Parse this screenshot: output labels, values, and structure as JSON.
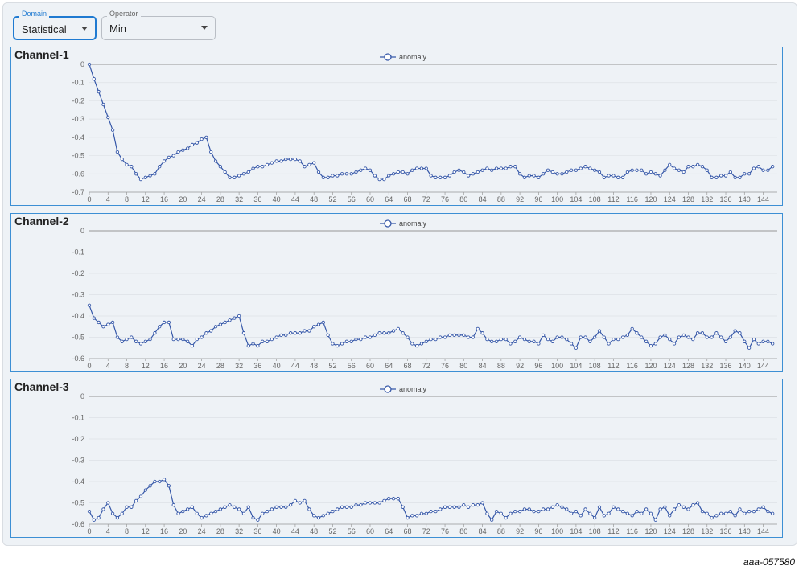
{
  "controls": {
    "domain": {
      "label": "Domain",
      "value": "Statistical"
    },
    "operator": {
      "label": "Operator",
      "value": "Min"
    }
  },
  "figure_id": "aaa-057580",
  "colors": {
    "series": "#3557a8",
    "panel_border": "#3c8fd4",
    "focus": "#1f7ad1",
    "axis": "#666666"
  },
  "chart_data": [
    {
      "type": "line",
      "title": "Channel-1",
      "legend": {
        "position": "top-center",
        "entries": [
          "anomaly"
        ]
      },
      "grid": true,
      "xlim": [
        0,
        147
      ],
      "ylim": [
        -0.7,
        0
      ],
      "x_ticks": [
        0,
        4,
        8,
        12,
        16,
        20,
        24,
        28,
        32,
        36,
        40,
        44,
        48,
        52,
        56,
        60,
        64,
        68,
        72,
        76,
        80,
        84,
        88,
        92,
        96,
        100,
        104,
        108,
        112,
        116,
        120,
        124,
        128,
        132,
        136,
        140,
        144
      ],
      "y_ticks": [
        "0",
        "-0.1",
        "-0.2",
        "-0.3",
        "-0.4",
        "-0.5",
        "-0.6",
        "-0.7"
      ],
      "series": [
        {
          "name": "anomaly",
          "values": [
            0,
            -0.08,
            -0.15,
            -0.22,
            -0.29,
            -0.36,
            -0.48,
            -0.52,
            -0.55,
            -0.56,
            -0.6,
            -0.63,
            -0.62,
            -0.61,
            -0.6,
            -0.56,
            -0.53,
            -0.51,
            -0.5,
            -0.48,
            -0.47,
            -0.46,
            -0.44,
            -0.43,
            -0.41,
            -0.4,
            -0.48,
            -0.53,
            -0.56,
            -0.59,
            -0.62,
            -0.62,
            -0.61,
            -0.6,
            -0.59,
            -0.57,
            -0.56,
            -0.56,
            -0.55,
            -0.54,
            -0.53,
            -0.53,
            -0.52,
            -0.52,
            -0.52,
            -0.53,
            -0.56,
            -0.55,
            -0.54,
            -0.59,
            -0.62,
            -0.62,
            -0.61,
            -0.61,
            -0.6,
            -0.6,
            -0.6,
            -0.59,
            -0.58,
            -0.57,
            -0.58,
            -0.61,
            -0.63,
            -0.63,
            -0.61,
            -0.6,
            -0.59,
            -0.59,
            -0.6,
            -0.58,
            -0.57,
            -0.57,
            -0.57,
            -0.61,
            -0.62,
            -0.62,
            -0.62,
            -0.61,
            -0.59,
            -0.58,
            -0.59,
            -0.61,
            -0.6,
            -0.59,
            -0.58,
            -0.57,
            -0.58,
            -0.57,
            -0.57,
            -0.57,
            -0.56,
            -0.56,
            -0.6,
            -0.62,
            -0.61,
            -0.61,
            -0.62,
            -0.6,
            -0.58,
            -0.59,
            -0.6,
            -0.6,
            -0.59,
            -0.58,
            -0.58,
            -0.57,
            -0.56,
            -0.57,
            -0.58,
            -0.59,
            -0.62,
            -0.61,
            -0.61,
            -0.62,
            -0.62,
            -0.59,
            -0.58,
            -0.58,
            -0.58,
            -0.6,
            -0.59,
            -0.6,
            -0.61,
            -0.58,
            -0.55,
            -0.57,
            -0.58,
            -0.59,
            -0.56,
            -0.56,
            -0.55,
            -0.56,
            -0.58,
            -0.62,
            -0.62,
            -0.61,
            -0.61,
            -0.59,
            -0.62,
            -0.62,
            -0.6,
            -0.6,
            -0.57,
            -0.56,
            -0.58,
            -0.58,
            -0.56
          ]
        }
      ]
    },
    {
      "type": "line",
      "title": "Channel-2",
      "legend": {
        "position": "top-center",
        "entries": [
          "anomaly"
        ]
      },
      "grid": true,
      "xlim": [
        0,
        147
      ],
      "ylim": [
        -0.6,
        0
      ],
      "x_ticks": [
        0,
        4,
        8,
        12,
        16,
        20,
        24,
        28,
        32,
        36,
        40,
        44,
        48,
        52,
        56,
        60,
        64,
        68,
        72,
        76,
        80,
        84,
        88,
        92,
        96,
        100,
        104,
        108,
        112,
        116,
        120,
        124,
        128,
        132,
        136,
        140,
        144
      ],
      "y_ticks": [
        "0",
        "-0.1",
        "-0.2",
        "-0.3",
        "-0.4",
        "-0.5",
        "-0.6"
      ],
      "series": [
        {
          "name": "anomaly",
          "values": [
            -0.35,
            -0.41,
            -0.43,
            -0.45,
            -0.44,
            -0.43,
            -0.5,
            -0.52,
            -0.51,
            -0.5,
            -0.52,
            -0.53,
            -0.52,
            -0.51,
            -0.48,
            -0.45,
            -0.43,
            -0.43,
            -0.51,
            -0.51,
            -0.51,
            -0.52,
            -0.54,
            -0.51,
            -0.5,
            -0.48,
            -0.47,
            -0.45,
            -0.44,
            -0.43,
            -0.42,
            -0.41,
            -0.4,
            -0.48,
            -0.54,
            -0.53,
            -0.54,
            -0.52,
            -0.52,
            -0.51,
            -0.5,
            -0.49,
            -0.49,
            -0.48,
            -0.48,
            -0.48,
            -0.47,
            -0.47,
            -0.45,
            -0.44,
            -0.43,
            -0.49,
            -0.53,
            -0.54,
            -0.53,
            -0.52,
            -0.52,
            -0.51,
            -0.51,
            -0.5,
            -0.5,
            -0.49,
            -0.48,
            -0.48,
            -0.48,
            -0.47,
            -0.46,
            -0.48,
            -0.5,
            -0.53,
            -0.54,
            -0.53,
            -0.52,
            -0.51,
            -0.51,
            -0.5,
            -0.5,
            -0.49,
            -0.49,
            -0.49,
            -0.49,
            -0.5,
            -0.5,
            -0.46,
            -0.48,
            -0.51,
            -0.52,
            -0.52,
            -0.51,
            -0.51,
            -0.53,
            -0.52,
            -0.5,
            -0.51,
            -0.52,
            -0.52,
            -0.53,
            -0.49,
            -0.51,
            -0.52,
            -0.5,
            -0.5,
            -0.51,
            -0.53,
            -0.55,
            -0.5,
            -0.5,
            -0.52,
            -0.5,
            -0.47,
            -0.5,
            -0.53,
            -0.51,
            -0.51,
            -0.5,
            -0.49,
            -0.46,
            -0.48,
            -0.5,
            -0.52,
            -0.54,
            -0.53,
            -0.5,
            -0.49,
            -0.51,
            -0.53,
            -0.5,
            -0.49,
            -0.5,
            -0.51,
            -0.48,
            -0.48,
            -0.5,
            -0.5,
            -0.48,
            -0.5,
            -0.52,
            -0.5,
            -0.47,
            -0.48,
            -0.52,
            -0.55,
            -0.51,
            -0.53,
            -0.52,
            -0.52,
            -0.53
          ]
        }
      ]
    },
    {
      "type": "line",
      "title": "Channel-3",
      "legend": {
        "position": "top-center",
        "entries": [
          "anomaly"
        ]
      },
      "grid": true,
      "xlim": [
        0,
        147
      ],
      "ylim": [
        -0.6,
        0
      ],
      "x_ticks": [
        0,
        4,
        8,
        12,
        16,
        20,
        24,
        28,
        32,
        36,
        40,
        44,
        48,
        52,
        56,
        60,
        64,
        68,
        72,
        76,
        80,
        84,
        88,
        92,
        96,
        100,
        104,
        108,
        112,
        116,
        120,
        124,
        128,
        132,
        136,
        140,
        144
      ],
      "y_ticks": [
        "0",
        "-0.1",
        "-0.2",
        "-0.3",
        "-0.4",
        "-0.5",
        "-0.6"
      ],
      "series": [
        {
          "name": "anomaly",
          "values": [
            -0.54,
            -0.58,
            -0.57,
            -0.53,
            -0.5,
            -0.55,
            -0.57,
            -0.55,
            -0.52,
            -0.52,
            -0.49,
            -0.47,
            -0.44,
            -0.42,
            -0.4,
            -0.4,
            -0.39,
            -0.42,
            -0.51,
            -0.55,
            -0.54,
            -0.53,
            -0.52,
            -0.55,
            -0.57,
            -0.56,
            -0.55,
            -0.54,
            -0.53,
            -0.52,
            -0.51,
            -0.52,
            -0.53,
            -0.55,
            -0.52,
            -0.57,
            -0.58,
            -0.55,
            -0.54,
            -0.53,
            -0.52,
            -0.52,
            -0.52,
            -0.51,
            -0.49,
            -0.5,
            -0.49,
            -0.53,
            -0.56,
            -0.57,
            -0.56,
            -0.55,
            -0.54,
            -0.53,
            -0.52,
            -0.52,
            -0.52,
            -0.51,
            -0.51,
            -0.5,
            -0.5,
            -0.5,
            -0.5,
            -0.49,
            -0.48,
            -0.48,
            -0.48,
            -0.52,
            -0.57,
            -0.56,
            -0.56,
            -0.55,
            -0.55,
            -0.54,
            -0.54,
            -0.53,
            -0.52,
            -0.52,
            -0.52,
            -0.52,
            -0.51,
            -0.52,
            -0.51,
            -0.51,
            -0.5,
            -0.55,
            -0.58,
            -0.54,
            -0.55,
            -0.57,
            -0.55,
            -0.54,
            -0.54,
            -0.53,
            -0.53,
            -0.54,
            -0.54,
            -0.53,
            -0.53,
            -0.52,
            -0.51,
            -0.52,
            -0.53,
            -0.55,
            -0.54,
            -0.56,
            -0.53,
            -0.55,
            -0.57,
            -0.52,
            -0.56,
            -0.55,
            -0.52,
            -0.53,
            -0.54,
            -0.55,
            -0.56,
            -0.54,
            -0.55,
            -0.53,
            -0.55,
            -0.58,
            -0.53,
            -0.52,
            -0.56,
            -0.53,
            -0.51,
            -0.52,
            -0.53,
            -0.51,
            -0.5,
            -0.54,
            -0.55,
            -0.57,
            -0.56,
            -0.55,
            -0.55,
            -0.54,
            -0.56,
            -0.53,
            -0.55,
            -0.54,
            -0.54,
            -0.53,
            -0.52,
            -0.54,
            -0.55
          ]
        }
      ]
    }
  ]
}
